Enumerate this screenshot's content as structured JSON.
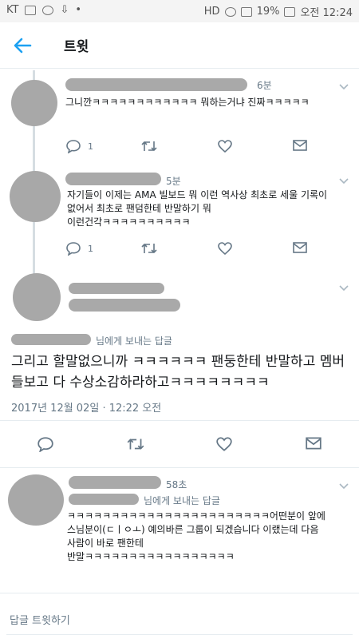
{
  "status_bar": {
    "carrier": "KT",
    "battery": "19%",
    "time_label": "오전 12:24",
    "network": "HD"
  },
  "header": {
    "title": "트윗",
    "back_icon": "arrow-left-icon"
  },
  "tweets": [
    {
      "time": "6분",
      "text": "그니깐ㅋㅋㅋㅋㅋㅋㅋㅋㅋㅋㅋㅋ 뭐하는거냐 진짜ㅋㅋㅋㅋㅋ",
      "reply_count": "1",
      "retweet_count": "",
      "like_count": ""
    },
    {
      "time": "5분",
      "text": "자기들이 이제는 AMA 빌보드 뭐 이런 역사상 최초로 세울 기록이\n없어서 최초로 팬덤한테 반말하기 뭐\n이런건각ㅋㅋㅋㅋㅋㅋㅋㅋㅋㅋ",
      "reply_count": "1",
      "retweet_count": "",
      "like_count": ""
    }
  ],
  "main_tweet": {
    "reply_to_suffix": "님에게 보내는 답글",
    "text": "그리고 할말없으니까 ㅋㅋㅋㅋㅋㅋ 팬둥한테 반말하고 멤버들보고 다 수상소감하라하고ㅋㅋㅋㅋㅋㅋㅋㅋ",
    "date": "2017년 12월 02일 · 12:22 오전"
  },
  "reply_tweet": {
    "time": "58초",
    "reply_to_suffix": "님에게 보내는 답글",
    "text": "ㅋㅋㅋㅋㅋㅋㅋㅋㅋㅋㅋㅋㅋㅋㅋㅋㅋㅋㅋㅋㅋㅋㅋ어떤분이 앞에\n스님분이(ㄷㅣㅇㅗ) 예의바른 그룹이 되겠습니다 이랬는데 다음\n사람이 바로 팬한테\n반말ㅋㅋㅋㅋㅋㅋㅋㅋㅋㅋㅋㅋㅋㅋㅋㅋㅋ"
  },
  "footer": {
    "reply_prompt": "답글 트윗하기"
  },
  "colors": {
    "accent": "#1da1f2",
    "text_primary": "#14171a",
    "text_secondary": "#657786",
    "icon_gray": "#657786"
  }
}
